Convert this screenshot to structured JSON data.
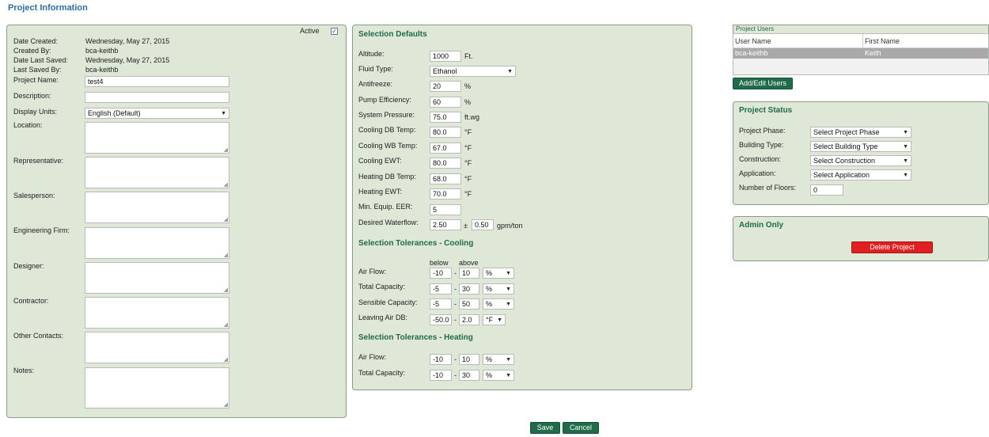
{
  "page_title": "Project Information",
  "project": {
    "active_label": "Active",
    "active_checked": true,
    "date_created_label": "Date Created:",
    "date_created": "Wednesday, May 27, 2015",
    "created_by_label": "Created By:",
    "created_by": "bca-keithb",
    "date_last_saved_label": "Date Last Saved:",
    "date_last_saved": "Wednesday, May 27, 2015",
    "last_saved_by_label": "Last Saved By:",
    "last_saved_by": "bca-keithb",
    "project_name_label": "Project Name:",
    "project_name": "test4",
    "description_label": "Description:",
    "description": "",
    "display_units_label": "Display Units:",
    "display_units": "English (Default)",
    "location_label": "Location:",
    "representative_label": "Representative:",
    "salesperson_label": "Salesperson:",
    "engineering_firm_label": "Engineering Firm:",
    "designer_label": "Designer:",
    "contractor_label": "Contractor:",
    "other_contacts_label": "Other Contacts:",
    "notes_label": "Notes:"
  },
  "defaults": {
    "title": "Selection Defaults",
    "rows": [
      {
        "label": "Altitude:",
        "value": "1000",
        "unit": "Ft."
      },
      {
        "label": "Fluid Type:",
        "value": "Ethanol",
        "unit": ""
      },
      {
        "label": "Antifreeze:",
        "value": "20",
        "unit": "%"
      },
      {
        "label": "Pump Efficiency:",
        "value": "60",
        "unit": "%"
      },
      {
        "label": "System Pressure:",
        "value": "75.0",
        "unit": "ft.wg"
      },
      {
        "label": "Cooling DB Temp:",
        "value": "80.0",
        "unit": "°F"
      },
      {
        "label": "Cooling WB Temp:",
        "value": "67.0",
        "unit": "°F"
      },
      {
        "label": "Cooling EWT:",
        "value": "80.0",
        "unit": "°F"
      },
      {
        "label": "Heating DB Temp:",
        "value": "68.0",
        "unit": "°F"
      },
      {
        "label": "Heating EWT:",
        "value": "70.0",
        "unit": "°F"
      },
      {
        "label": "Min. Equip. EER:",
        "value": "5",
        "unit": ""
      },
      {
        "label": "Desired Waterflow:",
        "value": "2.50",
        "unit": "gpm/ton"
      }
    ],
    "waterflow_pm": "±",
    "waterflow_tol": "0.50"
  },
  "tol_cooling": {
    "title": "Selection Tolerances - Cooling",
    "below_label": "below",
    "above_label": "above",
    "rows": [
      {
        "label": "Air Flow:",
        "below": "-10",
        "above": "10",
        "unit": "%"
      },
      {
        "label": "Total Capacity:",
        "below": "-5",
        "above": "30",
        "unit": "%"
      },
      {
        "label": "Sensible Capacity:",
        "below": "-5",
        "above": "50",
        "unit": "%"
      },
      {
        "label": "Leaving Air DB:",
        "below": "-50.0",
        "above": "2.0",
        "unit": "°F"
      }
    ]
  },
  "tol_heating": {
    "title": "Selection Tolerances - Heating",
    "rows": [
      {
        "label": "Air Flow:",
        "below": "-10",
        "above": "10",
        "unit": "%"
      },
      {
        "label": "Total Capacity:",
        "below": "-10",
        "above": "30",
        "unit": "%"
      }
    ]
  },
  "dash": "-",
  "users": {
    "title": "Project Users",
    "col_user": "User Name",
    "col_first": "First Name",
    "rows": [
      {
        "user": "bca-keithb",
        "first": "Keith"
      }
    ],
    "add_edit_label": "Add/Edit Users"
  },
  "status": {
    "title": "Project Status",
    "phase_label": "Project Phase:",
    "phase_value": "Select Project Phase",
    "building_label": "Building Type:",
    "building_value": "Select Building Type",
    "construction_label": "Construction:",
    "construction_value": "Select Construction",
    "application_label": "Application:",
    "application_value": "Select Application",
    "floors_label": "Number of Floors:",
    "floors_value": "0"
  },
  "admin": {
    "title": "Admin Only",
    "delete_label": "Delete Project"
  },
  "actions": {
    "save_label": "Save",
    "cancel_label": "Cancel"
  },
  "colors": {
    "panel_bg": "#dfe7d7",
    "accent_green": "#1f6b4a",
    "title_blue": "#2a6ea6",
    "danger_red": "#e02020"
  }
}
